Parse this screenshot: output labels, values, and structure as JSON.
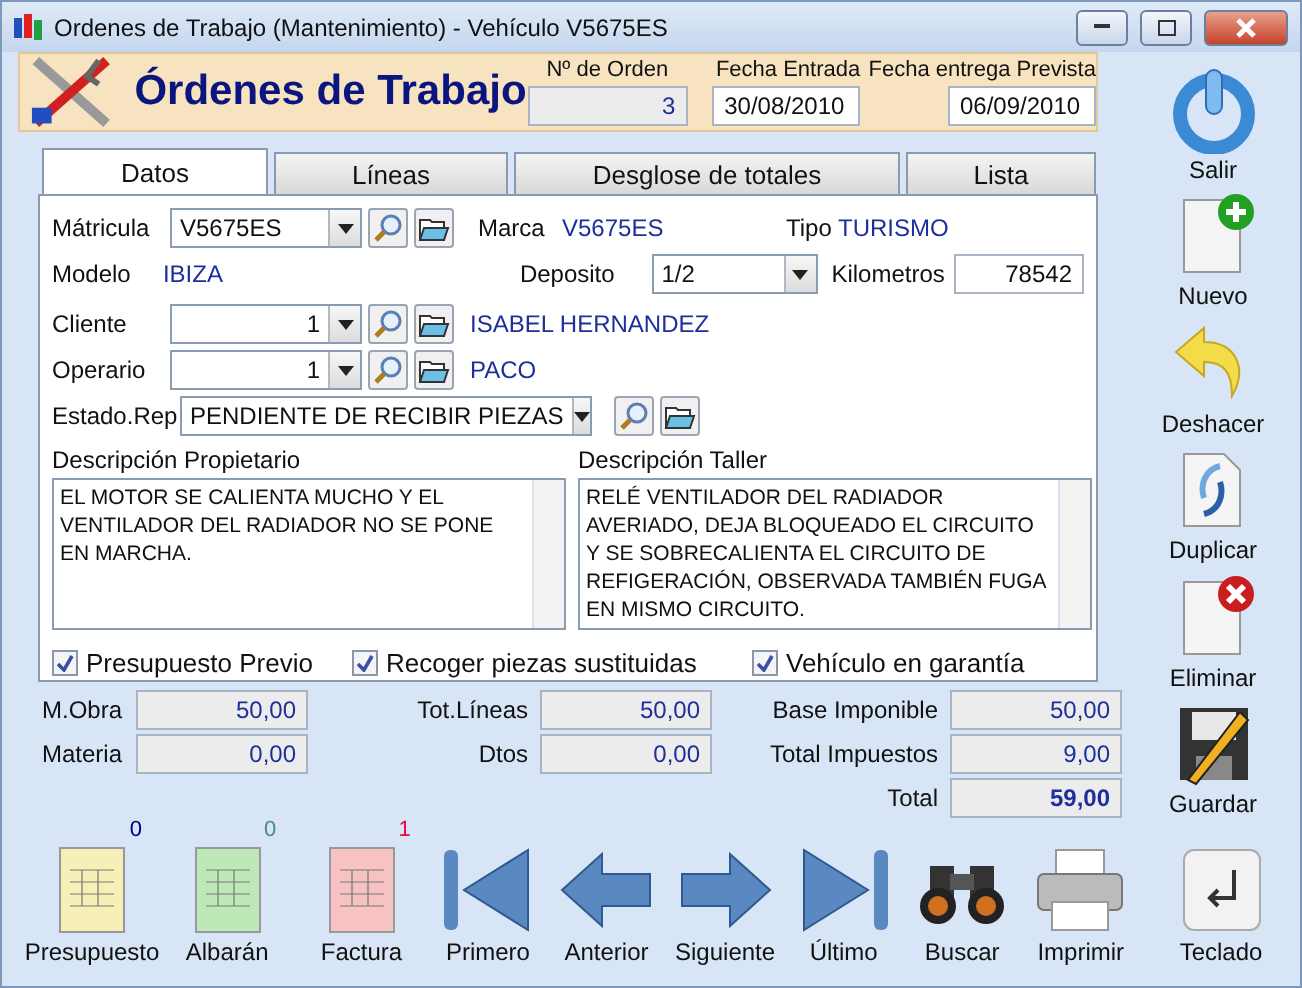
{
  "window": {
    "title": "Ordenes de Trabajo (Mantenimiento) - Vehículo V5675ES"
  },
  "header": {
    "title": "Órdenes de Trabajo",
    "order_label": "Nº de Orden",
    "order_value": "3",
    "entry_label": "Fecha Entrada",
    "entry_value": "30/08/2010",
    "due_label": "Fecha entrega Prevista",
    "due_value": "06/09/2010"
  },
  "tabs": [
    {
      "label": "Datos",
      "selected": true
    },
    {
      "label": "Líneas",
      "selected": false
    },
    {
      "label": "Desglose de totales",
      "selected": false
    },
    {
      "label": "Lista",
      "selected": false
    }
  ],
  "vehicle": {
    "plate_label": "Mátricula",
    "plate_value": "V5675ES",
    "brand_label": "Marca",
    "brand_value": "V5675ES",
    "type_label": "Tipo",
    "type_value": "TURISMO",
    "model_label": "Modelo",
    "model_value": "IBIZA",
    "tank_label": "Deposito",
    "tank_value": "1/2",
    "km_label": "Kilometros",
    "km_value": "78542"
  },
  "client": {
    "label": "Cliente",
    "value": "1",
    "name": "ISABEL HERNANDEZ"
  },
  "operator": {
    "label": "Operario",
    "value": "1",
    "name": "PACO"
  },
  "status": {
    "label": "Estado.Rep",
    "value": "PENDIENTE DE RECIBIR PIEZAS"
  },
  "descriptions": [
    {
      "label": "Descripción Propietario",
      "text": "EL MOTOR SE CALIENTA MUCHO Y EL VENTILADOR DEL RADIADOR NO SE PONE EN MARCHA."
    },
    {
      "label": "Descripción Taller",
      "text": "RELÉ VENTILADOR DEL RADIADOR AVERIADO, DEJA BLOQUEADO EL CIRCUITO Y SE SOBRECALIENTA EL CIRCUITO DE REFIGERACIÓN, OBSERVADA TAMBIÉN FUGA EN MISMO CIRCUITO."
    }
  ],
  "checks": [
    {
      "label": "Presupuesto Previo",
      "checked": true
    },
    {
      "label": "Recoger piezas sustituidas",
      "checked": true
    },
    {
      "label": "Vehículo en garantía",
      "checked": true
    }
  ],
  "totals": [
    [
      {
        "label": "M.Obra",
        "value": "50,00"
      },
      {
        "label": "Materia",
        "value": "0,00"
      }
    ],
    [
      {
        "label": "Tot.Líneas",
        "value": "50,00"
      },
      {
        "label": "Dtos",
        "value": "0,00"
      }
    ],
    [
      {
        "label": "Base Imponible",
        "value": "50,00"
      },
      {
        "label": "Total Impuestos",
        "value": "9,00"
      },
      {
        "label": "Total",
        "value": "59,00",
        "bold": true
      }
    ]
  ],
  "side_buttons": [
    {
      "label": "Salir",
      "kind": "exit"
    },
    {
      "label": "Nuevo",
      "kind": "new"
    },
    {
      "label": "Deshacer",
      "kind": "undo"
    },
    {
      "label": "Duplicar",
      "kind": "duplicate"
    },
    {
      "label": "Eliminar",
      "kind": "delete"
    },
    {
      "label": "Guardar",
      "kind": "save"
    }
  ],
  "toolbar": [
    {
      "label": "Presupuesto",
      "kind": "budget",
      "count": "0",
      "color": "#000080"
    },
    {
      "label": "Albarán",
      "kind": "delivery",
      "count": "0",
      "color": "#4a8a8a"
    },
    {
      "label": "Factura",
      "kind": "invoice",
      "count": "1",
      "color": "#e0103a"
    },
    {
      "label": "Primero",
      "kind": "first"
    },
    {
      "label": "Anterior",
      "kind": "prev"
    },
    {
      "label": "Siguiente",
      "kind": "next"
    },
    {
      "label": "Último",
      "kind": "last"
    },
    {
      "label": "Buscar",
      "kind": "search"
    },
    {
      "label": "Imprimir",
      "kind": "print"
    },
    {
      "label": "Teclado",
      "kind": "keyboard"
    }
  ]
}
